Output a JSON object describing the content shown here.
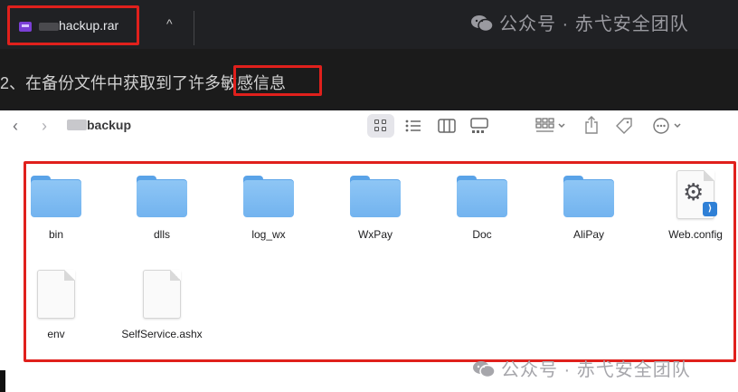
{
  "download_bar": {
    "file_name": "hackup.rar",
    "chevron": "^"
  },
  "watermark": {
    "text": "公众号 · 赤弋安全团队"
  },
  "caption": {
    "text": "2、在备份文件中获取到了许多敏感信息"
  },
  "finder": {
    "path_title": "backup",
    "toolbar_icons": [
      "back-icon",
      "forward-icon",
      "icon-view-icon",
      "list-view-icon",
      "column-view-icon",
      "gallery-view-icon",
      "group-icon",
      "share-icon",
      "tag-icon",
      "more-icon"
    ],
    "items": [
      {
        "name": "bin",
        "type": "folder"
      },
      {
        "name": "dlls",
        "type": "folder"
      },
      {
        "name": "log_wx",
        "type": "folder"
      },
      {
        "name": "WxPay",
        "type": "folder"
      },
      {
        "name": "Doc",
        "type": "folder"
      },
      {
        "name": "AliPay",
        "type": "folder"
      },
      {
        "name": "Web.config",
        "type": "config"
      },
      {
        "name": "env",
        "type": "file"
      },
      {
        "name": "SelfService.ashx",
        "type": "file"
      }
    ]
  },
  "colors": {
    "highlight_red": "#e0201c",
    "folder_blue": "#72b3ef",
    "dark_bg": "#1c1c1e"
  }
}
